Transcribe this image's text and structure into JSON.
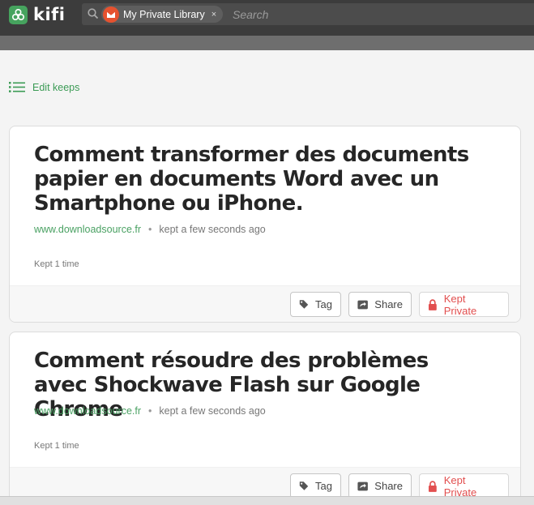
{
  "app": {
    "name": "kifi"
  },
  "search": {
    "library_chip": "My Private Library",
    "chip_close": "×",
    "placeholder": "Search"
  },
  "toolbar": {
    "edit_keeps_label": "Edit keeps"
  },
  "keeps": [
    {
      "title": "Comment transformer des documents papier en documents Word avec un Smartphone ou iPhone.",
      "url": "www.downloadsource.fr",
      "separator": "•",
      "kept_time": "kept a few seconds ago",
      "kept_count": "Kept 1 time",
      "tag_label": "Tag",
      "share_label": "Share",
      "private_label": "Kept Private"
    },
    {
      "title": "Comment résoudre des problèmes avec Shockwave Flash sur Google Chrome",
      "url": "www.downloadsource.fr",
      "separator": "•",
      "kept_time": "kept a few seconds ago",
      "kept_count": "Kept 1 time",
      "tag_label": "Tag",
      "share_label": "Share",
      "private_label": "Kept Private"
    }
  ],
  "colors": {
    "brand_green": "#46a35e",
    "private_red": "#e24f4f",
    "topbar": "#3c3c3c"
  }
}
